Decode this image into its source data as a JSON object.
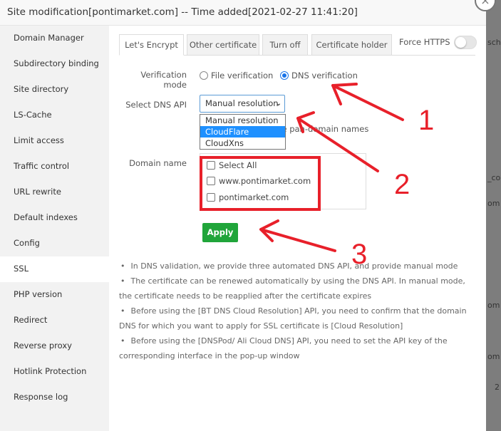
{
  "header": {
    "title": "Site modification[pontimarket.com] -- Time added[2021-02-27 11:41:20]"
  },
  "sidebar": {
    "items": [
      "Domain Manager",
      "Subdirectory binding",
      "Site directory",
      "LS-Cache",
      "Limit access",
      "Traffic control",
      "URL rewrite",
      "Default indexes",
      "Config",
      "SSL",
      "PHP version",
      "Redirect",
      "Reverse proxy",
      "Hotlink Protection",
      "Response log"
    ],
    "active": "SSL"
  },
  "tabs": [
    "Let's Encrypt",
    "Other certificate",
    "Turn off",
    "Certificate holder"
  ],
  "force_https": {
    "label": "Force HTTPS",
    "enabled": false
  },
  "verification": {
    "label": "Verification mode",
    "options": [
      "File verification",
      "DNS verification"
    ],
    "selected": "DNS verification"
  },
  "dns_api": {
    "label": "Select DNS API",
    "value": "Manual resolution",
    "options": [
      "Manual resolution",
      "CloudFlare",
      "CloudXns"
    ],
    "highlighted": "CloudFlare",
    "hint_partial": "ine pan-domain names"
  },
  "domain": {
    "label": "Domain name",
    "items": [
      "Select All",
      "www.pontimarket.com",
      "pontimarket.com"
    ]
  },
  "apply_label": "Apply",
  "notes": [
    "In DNS validation, we provide three automated DNS API, and provide manual mode",
    "The certificate can be renewed automatically by using the DNS API. In manual mode, the certificate needs to be reapplied after the certificate expires",
    "Before using the [BT DNS Cloud Resolution] API, you need to confirm that the domain DNS for which you want to apply for SSL certificate is [Cloud Resolution]",
    "Before using the [DNSPod/ Ali Cloud DNS] API, you need to set the API key of the corresponding interface in the pop-up window"
  ],
  "background_fragments": [
    "sch",
    "_cor",
    "om",
    "om",
    "om",
    "2"
  ],
  "annotations": [
    "1",
    "2",
    "3"
  ],
  "colors": {
    "accent": "#20a53a",
    "annotation": "#e8202a",
    "selected_option": "#1e90ff"
  }
}
